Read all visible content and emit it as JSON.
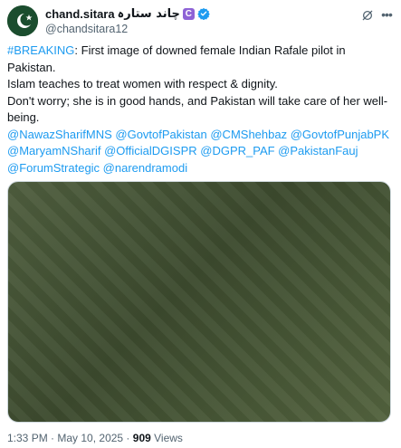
{
  "post": {
    "author": {
      "display_name": "chand.sitara",
      "urdu_name": "چاند ستارہ",
      "badge_letter": "C",
      "handle": "@chandsitara12",
      "avatar_icon": "pakistan-flag-avatar",
      "verified_color": "#1d9bf0"
    },
    "body": {
      "hashtag": "#BREAKING",
      "line1_rest": ": First image of downed female Indian Rafale pilot in Pakistan.",
      "line2": "Islam teaches to treat women with respect & dignity.",
      "line3": "Don't worry; she is in good hands, and Pakistan will take care of her well-being.",
      "mentions": "@NawazSharifMNS @GovtofPakistan @CMShehbaz @GovtofPunjabPK @MaryamNSharif @OfficialDGISPR @DGPR_PAF @PakistanFauj @ForumStrategic @narendramodi"
    },
    "meta": {
      "time": "1:33 PM",
      "separator1": " · ",
      "date": "May 10, 2025",
      "separator2": " · ",
      "views_count": "909",
      "views_label": " Views"
    },
    "icons": {
      "grok": "grok-icon",
      "more": "more-icon"
    },
    "colors": {
      "link": "#1d9bf0",
      "text": "#0f1419",
      "muted": "#536471"
    }
  }
}
